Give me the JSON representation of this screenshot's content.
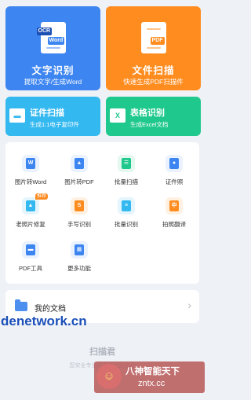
{
  "main_cards": {
    "ocr": {
      "title": "文字识别",
      "subtitle": "提取文字/生成Word",
      "icon_tag": "OCR",
      "icon_label": "Word",
      "color": "#3d85f0"
    },
    "scan": {
      "title": "文件扫描",
      "subtitle": "快速生成PDF扫描件",
      "icon_label": "PDF",
      "color": "#ff8c1f"
    }
  },
  "sub_cards": {
    "id_scan": {
      "title": "证件扫描",
      "subtitle": "生成1:1电子复印件",
      "color": "#33b8f0"
    },
    "table": {
      "title": "表格识别",
      "subtitle": "生成Excel文档",
      "icon": "X",
      "color": "#1fc88c"
    }
  },
  "tools": [
    {
      "label": "图片转Word",
      "icon": "W",
      "color": "#3d85f0"
    },
    {
      "label": "图片转PDF",
      "icon": "▲",
      "color": "#3d85f0"
    },
    {
      "label": "批量扫描",
      "icon": "☰",
      "color": "#1fc88c"
    },
    {
      "label": "证件照",
      "icon": "●",
      "color": "#3d85f0"
    },
    {
      "label": "老照片修复",
      "icon": "▲",
      "color": "#33b8f0",
      "badge": "推荐"
    },
    {
      "label": "手写识别",
      "icon": "S",
      "color": "#ff8c1f"
    },
    {
      "label": "批量识别",
      "icon": "≡",
      "color": "#33b8f0"
    },
    {
      "label": "拍照翻译",
      "icon": "中",
      "color": "#ff8c1f"
    },
    {
      "label": "PDF工具",
      "icon": "▬",
      "color": "#3d85f0"
    },
    {
      "label": "更多功能",
      "icon": "▦",
      "color": "#3d85f0"
    }
  ],
  "my_docs": {
    "label": "我的文档",
    "arrow": "›"
  },
  "footer": {
    "app_name": "扫描君",
    "slogan": "您安全专业的文字识别工具"
  },
  "watermarks": {
    "site_left": "denetwork.cn",
    "brand": "八神智能天下",
    "domain": "zntx.cc",
    "logo_char": "☺"
  }
}
